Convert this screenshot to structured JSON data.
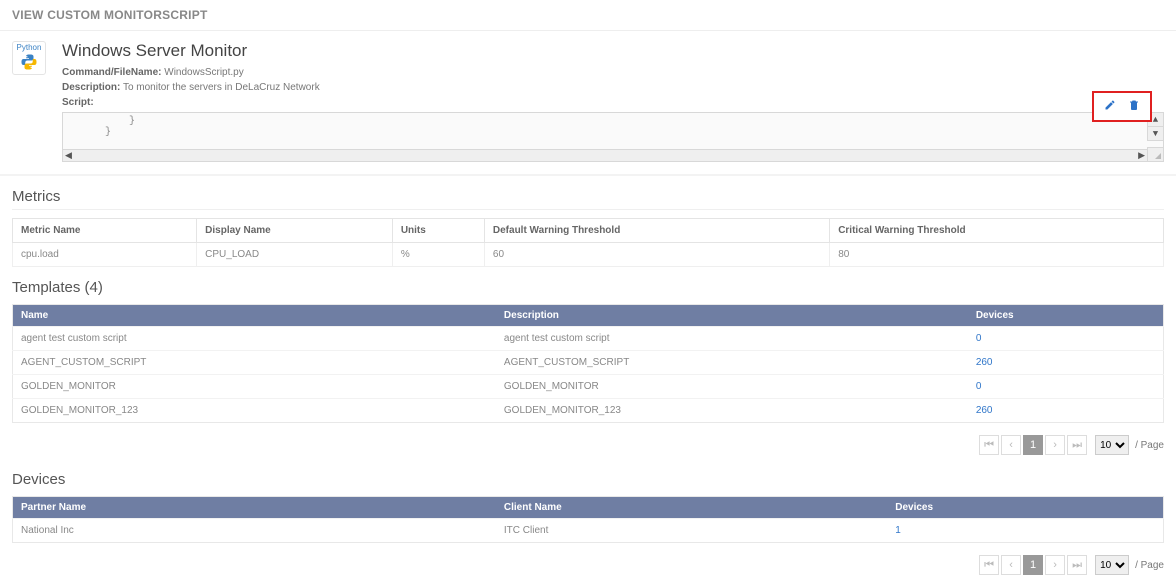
{
  "page_title": "VIEW CUSTOM MONITORSCRIPT",
  "lang": {
    "label": "Python"
  },
  "monitor": {
    "title": "Windows Server Monitor",
    "command_label": "Command/FileName:",
    "command_value": "WindowsScript.py",
    "description_label": "Description:",
    "description_value": "To monitor the servers in DeLaCruz Network",
    "script_label": "Script:",
    "script_body": "       }\n   }"
  },
  "metrics": {
    "title": "Metrics",
    "headers": [
      "Metric Name",
      "Display Name",
      "Units",
      "Default Warning Threshold",
      "Critical Warning Threshold"
    ],
    "rows": [
      {
        "name": "cpu.load",
        "display": "CPU_LOAD",
        "units": "%",
        "warn": "60",
        "crit": "80"
      }
    ]
  },
  "templates": {
    "title": "Templates (4)",
    "headers": [
      "Name",
      "Description",
      "Devices"
    ],
    "rows": [
      {
        "name": "agent test custom script",
        "desc": "agent test custom script",
        "devices": "0"
      },
      {
        "name": "AGENT_CUSTOM_SCRIPT",
        "desc": "AGENT_CUSTOM_SCRIPT",
        "devices": "260"
      },
      {
        "name": "GOLDEN_MONITOR",
        "desc": "GOLDEN_MONITOR",
        "devices": "0"
      },
      {
        "name": "GOLDEN_MONITOR_123",
        "desc": "GOLDEN_MONITOR_123",
        "devices": "260"
      }
    ]
  },
  "devices": {
    "title": "Devices",
    "headers": [
      "Partner Name",
      "Client Name",
      "Devices"
    ],
    "rows": [
      {
        "partner": "National Inc",
        "client": "ITC Client",
        "devices": "1"
      }
    ]
  },
  "pagination": {
    "current": "1",
    "page_size": "10",
    "per_label": "/ Page"
  }
}
